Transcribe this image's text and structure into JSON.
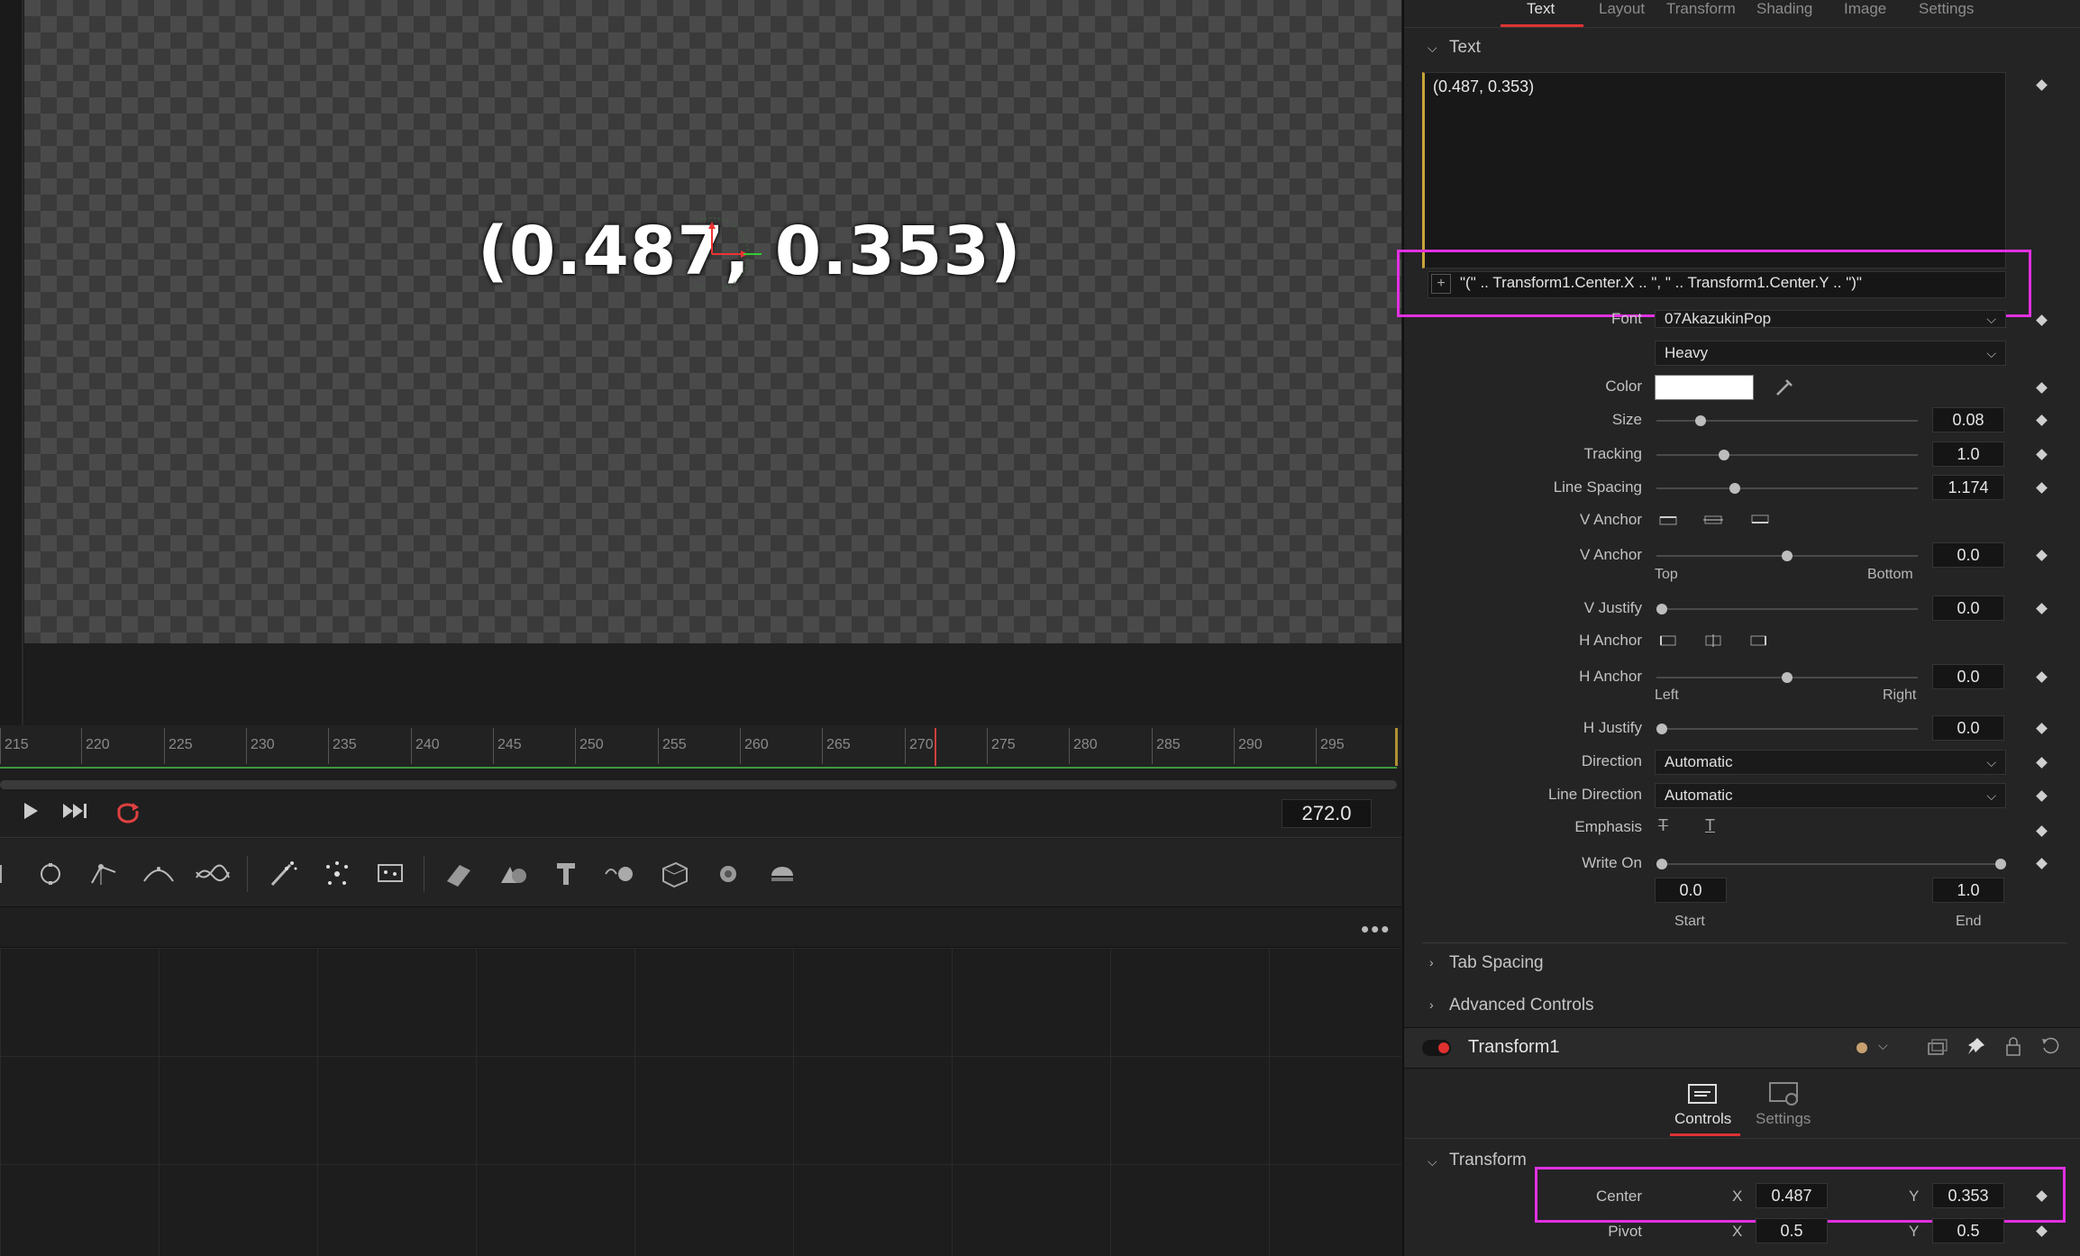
{
  "viewer": {
    "overlay_text": "(0.487, 0.353)",
    "timecode": "272.0",
    "ruler_ticks": [
      "215",
      "220",
      "225",
      "230",
      "235",
      "240",
      "245",
      "250",
      "255",
      "260",
      "265",
      "270",
      "275",
      "280",
      "285",
      "290",
      "295"
    ]
  },
  "toolbar_icons": [
    "rectangle-mask-icon",
    "ellipse-mask-icon",
    "polygon-mask-icon",
    "bspline-icon",
    "paint-icon",
    "particle-emitter-icon",
    "particle-icon",
    "particle-render-icon",
    "image-plane-3d-icon",
    "shape-3d-icon",
    "text-3d-icon",
    "merge-3d-icon",
    "renderer-3d-icon",
    "camera-3d-icon",
    "spotlight-icon"
  ],
  "inspector": {
    "tabs": [
      "Text",
      "Layout",
      "Transform",
      "Shading",
      "Image",
      "Settings"
    ],
    "active_tab": "Text",
    "text_section": "Text",
    "styled_text": "(0.487, 0.353)",
    "expression": "\"(\" .. Transform1.Center.X .. \", \" .. Transform1.Center.Y .. \")\"",
    "font_label": "Font",
    "font_value": "07AkazukinPop",
    "style_value": "Heavy",
    "color_label": "Color",
    "size_label": "Size",
    "size_value": "0.08",
    "size_frac": 0.17,
    "tracking_label": "Tracking",
    "tracking_value": "1.0",
    "tracking_frac": 0.26,
    "line_spacing_label": "Line Spacing",
    "line_spacing_value": "1.174",
    "line_spacing_frac": 0.3,
    "vanchor_label": "V Anchor",
    "vanchor2_label": "V Anchor",
    "vanchor_value": "0.0",
    "vanchor_frac": 0.5,
    "top_label": "Top",
    "bottom_label": "Bottom",
    "vjustify_label": "V Justify",
    "vjustify_value": "0.0",
    "vjustify_frac": 0.02,
    "hanchor_label": "H Anchor",
    "hanchor2_label": "H Anchor",
    "hanchor_value": "0.0",
    "hanchor_frac": 0.5,
    "left_label": "Left",
    "right_label": "Right",
    "hjustify_label": "H Justify",
    "hjustify_value": "0.0",
    "hjustify_frac": 0.02,
    "direction_label": "Direction",
    "direction_value": "Automatic",
    "line_direction_label": "Line Direction",
    "line_direction_value": "Automatic",
    "emphasis_label": "Emphasis",
    "write_on_label": "Write On",
    "write_on_start": "0.0",
    "write_on_end": "1.0",
    "start_label": "Start",
    "end_label": "End",
    "tab_spacing": "Tab Spacing",
    "advanced_controls": "Advanced Controls",
    "tool_name": "Transform1",
    "sub_tabs": [
      "Controls",
      "Settings"
    ],
    "transform_section": "Transform",
    "center_label": "Center",
    "x_label": "X",
    "y_label": "Y",
    "center_x": "0.487",
    "center_y": "0.353",
    "pivot_label": "Pivot",
    "pivot_x": "0.5",
    "pivot_y": "0.5"
  },
  "colors": {
    "accent": "#d33333",
    "highlight": "#e130e1",
    "playhead": "#d04040",
    "keyframe_line": "#c9a43a",
    "green_line": "#3c9a3c"
  }
}
